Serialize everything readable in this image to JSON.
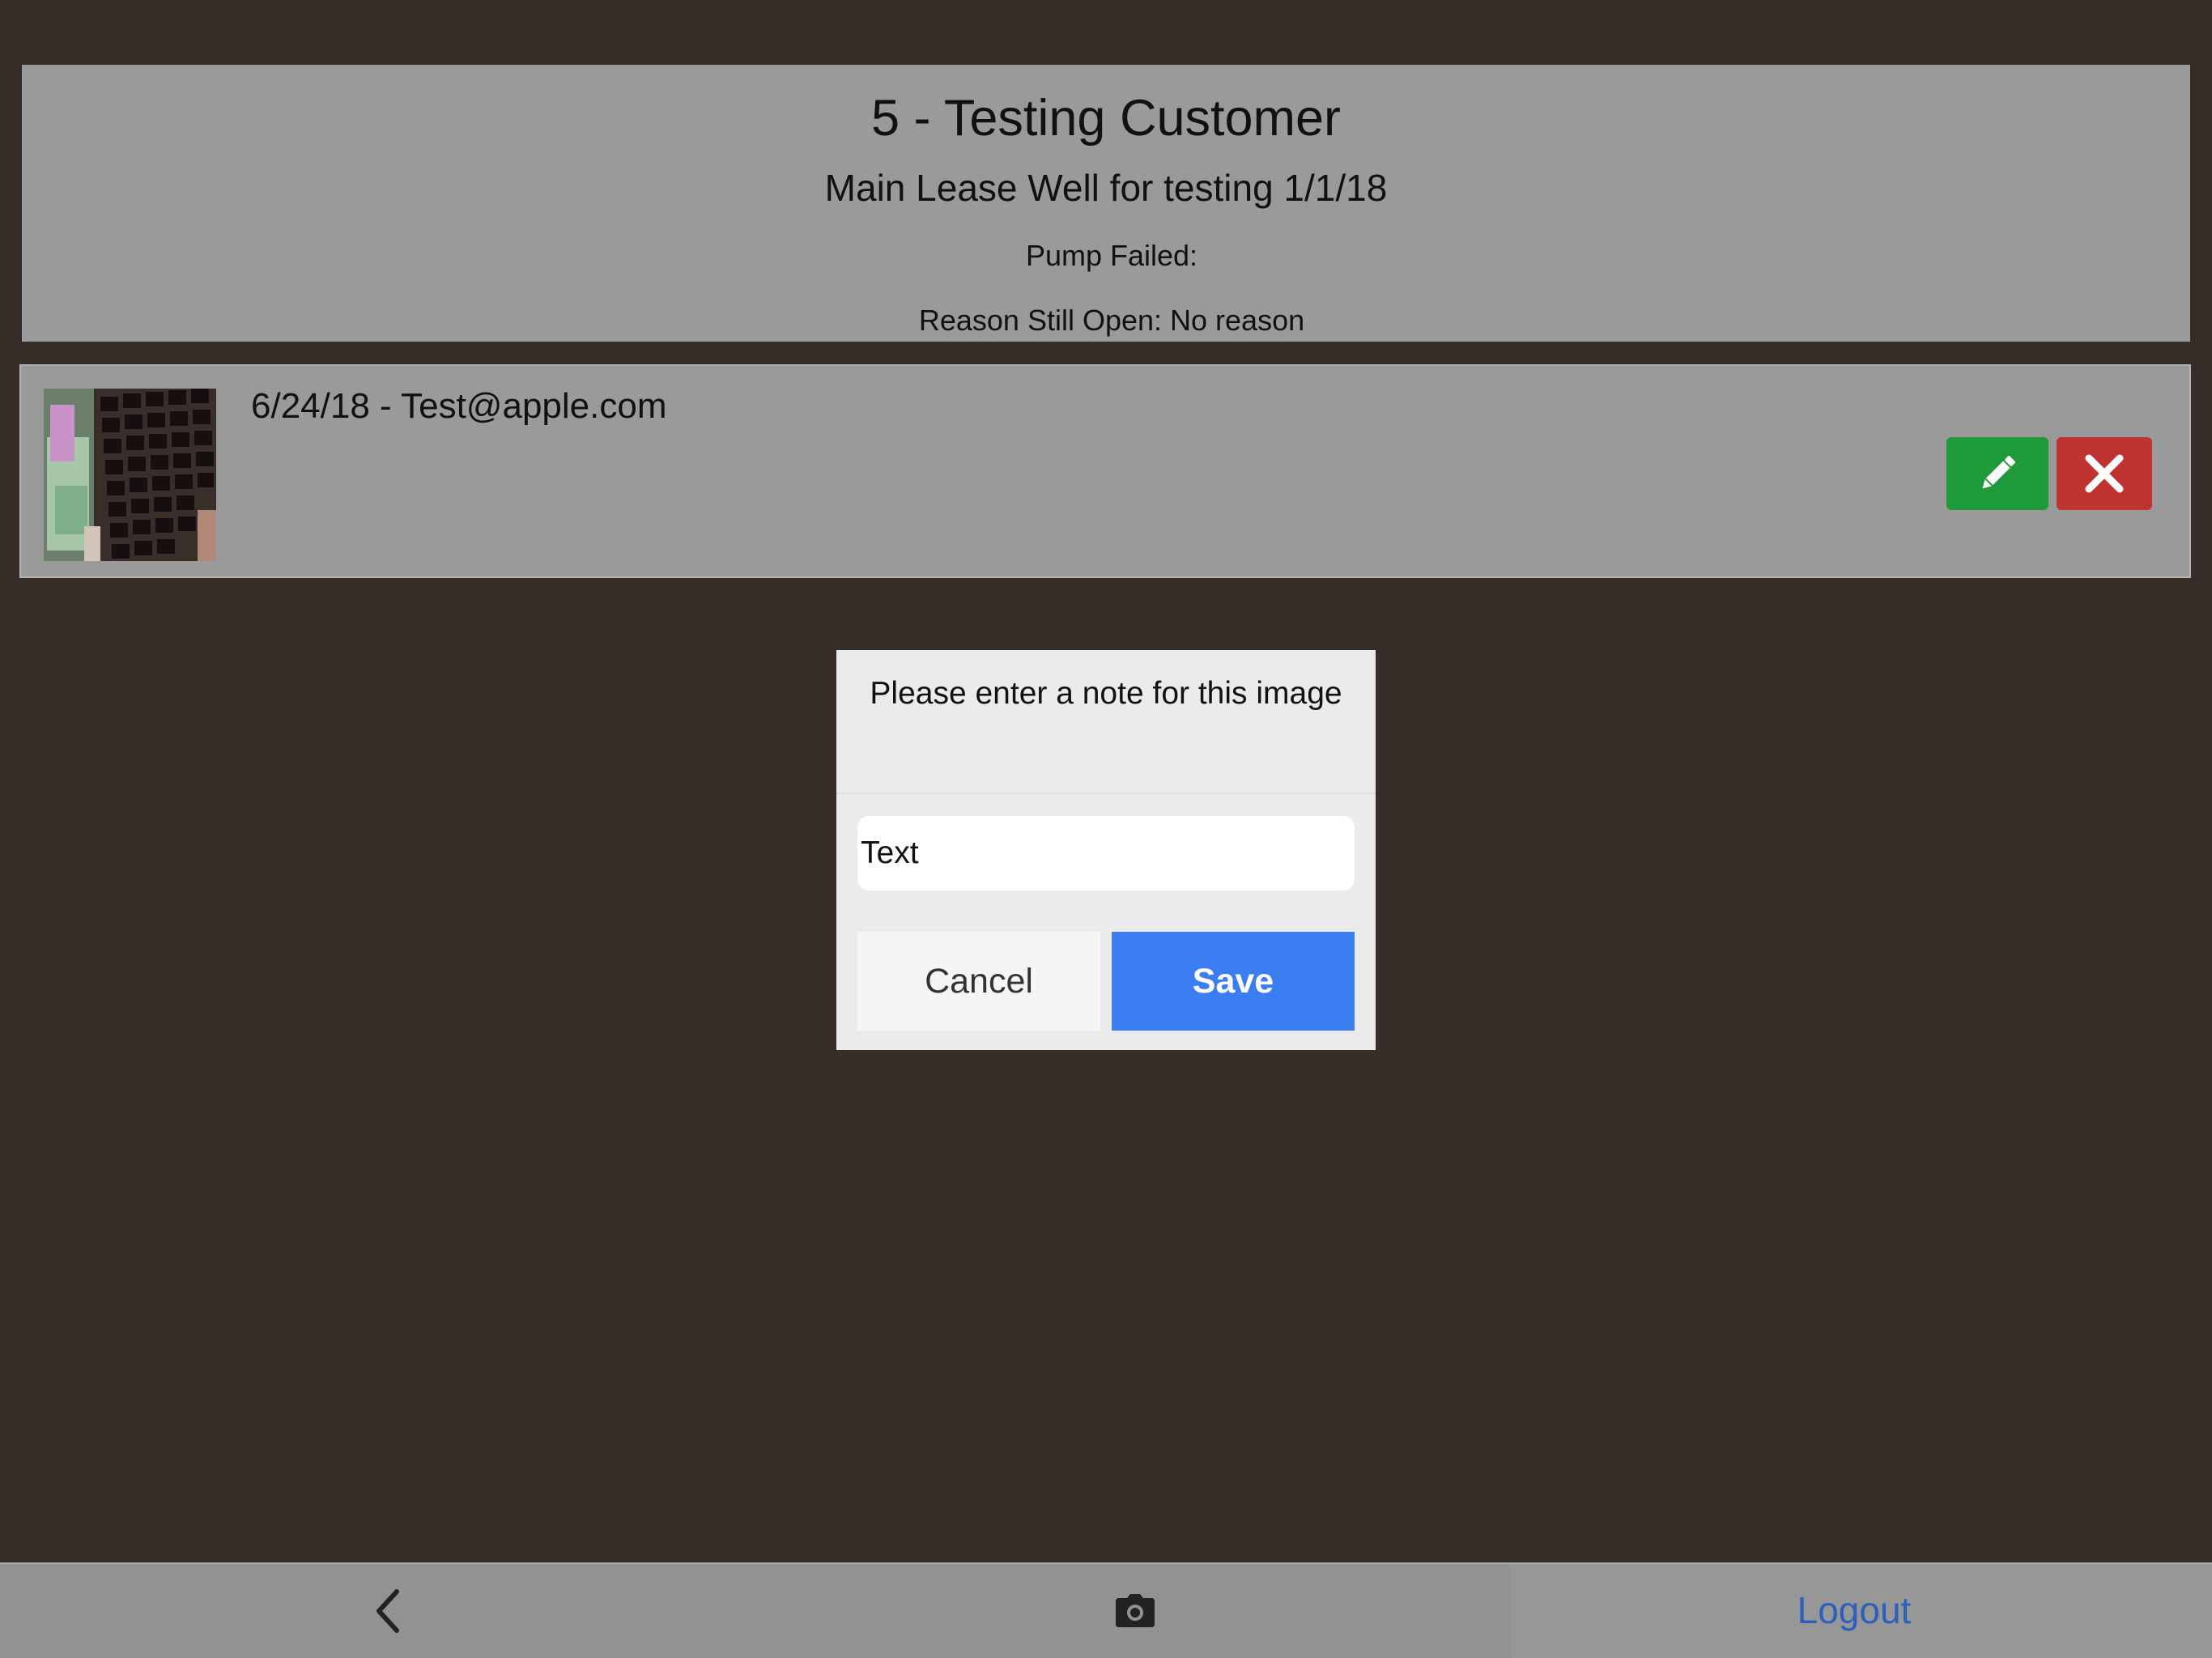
{
  "header": {
    "title": "5 - Testing Customer",
    "subtitle": "Main Lease Well for testing 1/1/18",
    "status": "Pump Failed:",
    "reason": "Reason Still Open: No reason"
  },
  "entry": {
    "text": "6/24/18 - Test@apple.com",
    "thumbnail_icon": "photo-thumbnail",
    "edit_icon": "pencil-icon",
    "delete_icon": "close-icon"
  },
  "modal": {
    "title": "Please enter a note for this image",
    "input_placeholder": "Text",
    "input_value": "",
    "cancel_label": "Cancel",
    "save_label": "Save"
  },
  "bottom_nav": {
    "back_icon": "chevron-left-icon",
    "camera_icon": "camera-icon",
    "logout_label": "Logout"
  },
  "colors": {
    "background": "#372d28",
    "panel": "#9a9a9a",
    "edit_button": "#1f9a3a",
    "delete_button": "#c03333",
    "save_button": "#3a7ef2",
    "logout_link": "#2d5fbf"
  }
}
